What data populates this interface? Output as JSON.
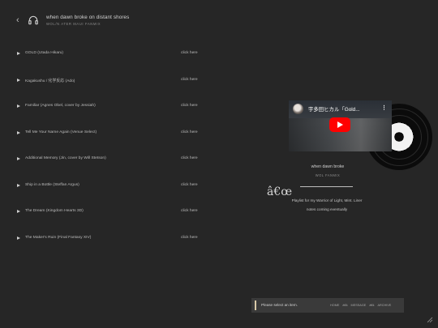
{
  "header": {
    "back_icon": "chevron-left-icon",
    "icon": "headphones-icon",
    "title": "when dawn broke on distant shores",
    "subtitle": "WOL/N ATER MAUI FANMIX"
  },
  "tracks": [
    {
      "title": "GOLD (Utada Hikaru)",
      "link": "click here"
    },
    {
      "title": "Kagakushu / 化学反応 (Ado)",
      "link": "click here"
    },
    {
      "title": "Familiar (Agnes Obel, cover by Jessiah)",
      "link": "click here"
    },
    {
      "title": "Tell Me Your Name Again (Venue Select)",
      "link": "click here"
    },
    {
      "title": "Additional Memory (Jin, cover by Will Stetson)",
      "link": "click here"
    },
    {
      "title": "Ship in a Bottle (Steffan Argus)",
      "link": "click here"
    },
    {
      "title": "The Dream (Kingdom Hearts 3D)",
      "link": "click here"
    },
    {
      "title": "The Maker's Ruin (Final Fantasy XIV)",
      "link": "click here"
    }
  ],
  "video": {
    "title": "宇多田ヒカル「Gold...",
    "more_icon": "more-vertical-icon",
    "play_icon": "youtube-play-icon"
  },
  "info": {
    "title": "when dawn broke",
    "subtitle": "WOL FANMIX",
    "glyph": "â€œ",
    "description": "Playlist for my Warrior of Light, Mint. Liner notes coming eventually"
  },
  "statusbar": {
    "message": "Please select an item.",
    "nav": [
      "HOME",
      "â€š",
      "MESSAGE",
      "â€š",
      "ARCHIVE"
    ]
  },
  "corner_icon": "resize-icon",
  "colors": {
    "background": "#262626",
    "bar": "#3a3a3a",
    "accent": "#d8c9a8",
    "youtube_red": "#ff0000"
  }
}
